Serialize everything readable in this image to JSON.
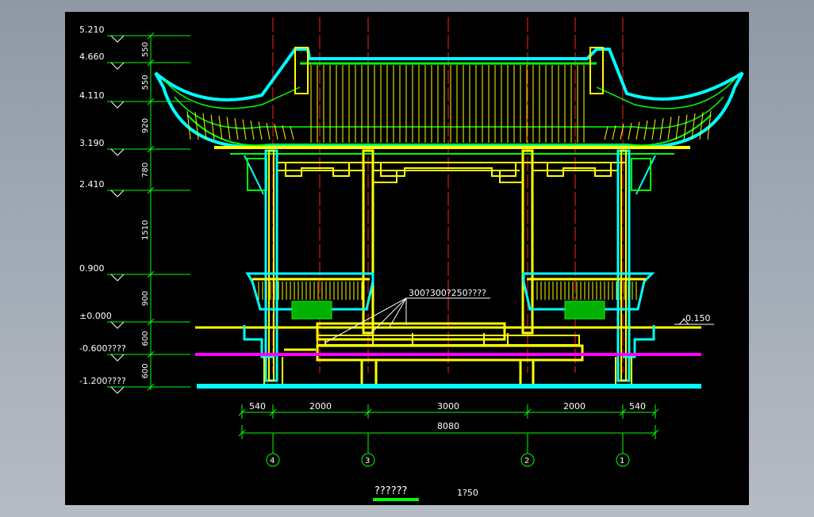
{
  "drawing": {
    "levels": [
      "5.210",
      "4.660",
      "4.110",
      "3.190",
      "2.410",
      "0.900",
      "±0.000",
      "-0.600????",
      "-1.200????"
    ],
    "level_right": "-0.150",
    "heights": [
      "550",
      "550",
      "920",
      "780",
      "1510",
      "900",
      "600",
      "600"
    ],
    "spans": [
      "540",
      "2000",
      "3000",
      "2000",
      "540"
    ],
    "total": "8080",
    "axes": [
      "4",
      "3",
      "2",
      "1"
    ],
    "note": "300?300?250????",
    "title": "??????",
    "scale": "1?50"
  },
  "colors": {
    "background": "#000000",
    "roof": "#00ff00",
    "outline": "#00ffff",
    "timber": "#ffff00",
    "axis": "#ff2020",
    "dim": "#00ff00",
    "text": "#ffffff",
    "ground": "#ff00ff"
  }
}
